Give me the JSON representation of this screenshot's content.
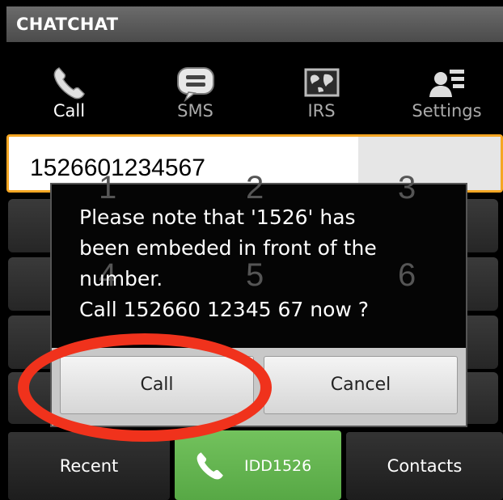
{
  "app": {
    "title": "CHATCHAT"
  },
  "tabs": [
    {
      "label": "Call",
      "icon": "phone-icon"
    },
    {
      "label": "SMS",
      "icon": "chat-bubble-icon"
    },
    {
      "label": "IRS",
      "icon": "globe-map-icon"
    },
    {
      "label": "Settings",
      "icon": "user-list-icon"
    }
  ],
  "number_input": {
    "value": "1526601234567"
  },
  "keypad": {
    "digits": [
      "1",
      "2",
      "3",
      "4",
      "5",
      "6"
    ]
  },
  "dialog": {
    "message_lines": [
      "Please note that '1526' has",
      "been embeded in front of the",
      "number.",
      "Call 152660 12345 67 now ?"
    ],
    "call_label": "Call",
    "cancel_label": "Cancel"
  },
  "bottom_bar": {
    "recent_label": "Recent",
    "idd_label": "IDD1526",
    "contacts_label": "Contacts"
  },
  "colors": {
    "accent_orange": "#f5a623",
    "idd_green": "#5cb04a",
    "highlight_red": "#f0321c"
  }
}
